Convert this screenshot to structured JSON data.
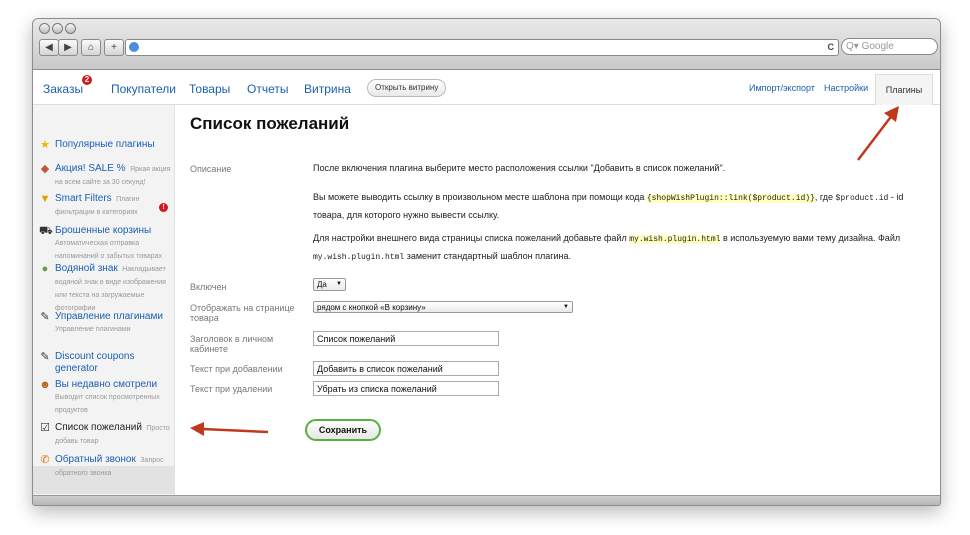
{
  "browser": {
    "nav_back": "◀",
    "nav_forward": "▶",
    "home_icon": "⌂",
    "add_icon": "+",
    "reload_icon": "C",
    "search_placeholder": "Q▾ Google"
  },
  "nav": {
    "orders": "Заказы",
    "orders_badge": "2",
    "customers": "Покупатели",
    "products": "Товары",
    "reports": "Отчеты",
    "storefront": "Витрина",
    "open_storefront": "Открыть витрину",
    "import_export": "Импорт/экспорт",
    "settings": "Настройки",
    "plugins": "Плагины"
  },
  "sidebar": {
    "items": [
      {
        "title": "Популярные плагины",
        "desc": "",
        "icon": "star-icon",
        "glyph": "★",
        "color": "#f0b400"
      },
      {
        "title": "Акция! SALE %",
        "desc": "Яркая акция на всем сайте за 30 секунд!",
        "icon": "sale-icon",
        "glyph": "◆",
        "color": "#c0563a"
      },
      {
        "title": "Smart Filters",
        "desc": "Плагин фильтрации в категориях",
        "icon": "filter-icon",
        "glyph": "▼",
        "color": "#e0a000"
      },
      {
        "title": "Брошенные корзины",
        "desc": "Автоматическая отправка напоминаний о забытых товарах",
        "icon": "cart-icon",
        "glyph": "⛟",
        "color": "#333333",
        "alert": "!"
      },
      {
        "title": "Водяной знак",
        "desc": "Накладывает водяной знак в виде изображения или текста на загружаемые фотографии",
        "icon": "watermark-icon",
        "glyph": "●",
        "color": "#5aa24a"
      },
      {
        "title": "Управление плагинами",
        "desc": "Управление плагинами",
        "icon": "plug-icon",
        "glyph": "✎",
        "color": "#333333"
      },
      {
        "title": "Discount coupons generator",
        "desc": "",
        "icon": "coupon-icon",
        "glyph": "✎",
        "color": "#333333"
      },
      {
        "title": "Вы недавно смотрели",
        "desc": "Выводит список просмотренных продуктов",
        "icon": "viewed-icon",
        "glyph": "☻",
        "color": "#b5651d"
      },
      {
        "title": "Список пожеланий",
        "desc": "Просто добавь товар",
        "icon": "wishlist-icon",
        "glyph": "☑",
        "color": "#333333"
      },
      {
        "title": "Обратный звонок",
        "desc": "Запрос обратного звонка",
        "icon": "phone-icon",
        "glyph": "✆",
        "color": "#e07000"
      }
    ]
  },
  "main": {
    "title": "Список пожеланий",
    "description_label": "Описание",
    "desc1": "После включения плагина выберите место расположения ссылки \"Добавить в список пожеланий\".",
    "desc2_a": "Вы можете выводить ссылку в произвольном месте шаблона при помощи кода ",
    "desc2_code": "{shopWishPlugin::link($product.id)}",
    "desc2_b": ", где ",
    "desc2_var": "$product.id",
    "desc2_c": " - id товара, для которого нужно вывести ссылку.",
    "desc3_a": "Для настройки внешнего вида страницы списка пожеланий добавьте файл ",
    "desc3_file": "my.wish.plugin.html",
    "desc3_b": " в используемую вами тему дизайна. Файл ",
    "desc3_file2": "my.wish.plugin.html",
    "desc3_c": " заменит стандартный шаблон плагина.",
    "enabled_label": "Включен",
    "enabled_value": "Да",
    "display_label": "Отображать на странице товара",
    "display_value": "рядом с кнопкой «В корзину»",
    "cabinet_label": "Заголовок в личном кабинете",
    "cabinet_value": "Список пожеланий",
    "add_label": "Текст при добавлении",
    "add_value": "Добавить в список пожеланий",
    "remove_label": "Текст при удалении",
    "remove_value": "Убрать из списка пожеланий",
    "save": "Сохранить"
  },
  "colors": {
    "link": "#1a5fb4",
    "annotation_arrow": "#c0391b",
    "save_border": "#58b13e",
    "badge": "#d4181c"
  }
}
